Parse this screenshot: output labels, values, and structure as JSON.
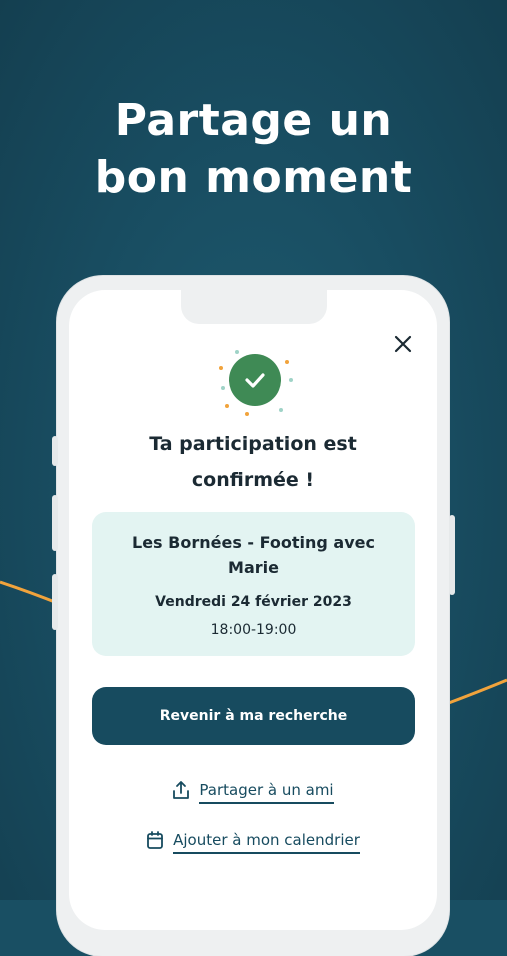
{
  "headline": {
    "line1": "Partage un",
    "line2": "bon moment"
  },
  "colors": {
    "background": "#194f63",
    "accent_orange": "#f1a33c",
    "primary": "#174b5f",
    "success": "#3f8a55",
    "card_bg": "#e3f4f2"
  },
  "modal": {
    "close_icon": "close-icon",
    "status_icon": "check-circle-icon",
    "title_line1": "Ta participation est",
    "title_line2": "confirmée !",
    "event": {
      "name": "Les Bornées - Footing avec Marie",
      "date": "Vendredi 24 février 2023",
      "time": "18:00-19:00"
    },
    "primary_button": "Revenir à ma recherche",
    "share_link": {
      "icon": "share-icon",
      "label": "Partager à un ami"
    },
    "calendar_link": {
      "icon": "calendar-icon",
      "label": "Ajouter à mon calendrier"
    }
  }
}
